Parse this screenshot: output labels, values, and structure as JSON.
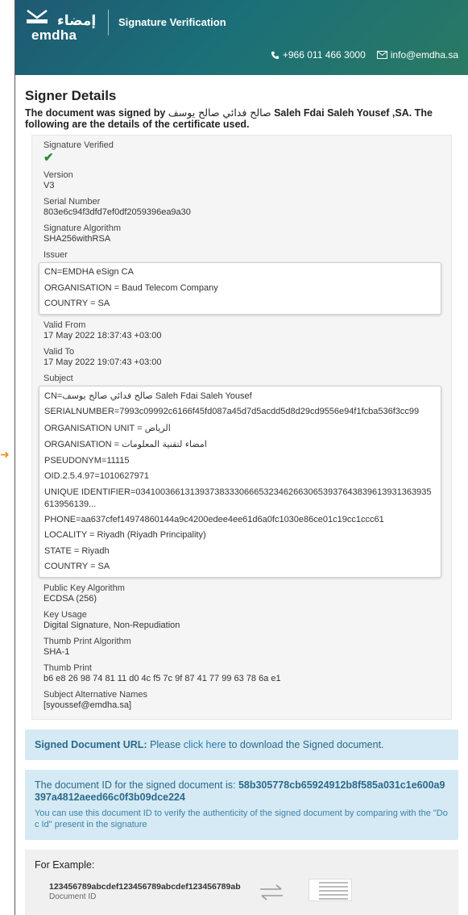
{
  "header": {
    "logo_ar": "إمضاء",
    "logo_en": "emdha",
    "title": "Signature Verification",
    "phone": "+966 011 466 3000",
    "email": "info@emdha.sa",
    "colors": {
      "gradient_start": "#1e5a73",
      "gradient_end": "#2a7a63"
    }
  },
  "page": {
    "title": "Signer Details",
    "intro_prefix": "The document was signed by",
    "signer_ar": "صالح فدائي صالح يوسف",
    "intro_suffix": "Saleh Fdai Saleh Yousef ,SA. The following are the details of the certificate used."
  },
  "details": {
    "signature_verified_label": "Signature Verified",
    "version_label": "Version",
    "version": "V3",
    "serial_label": "Serial Number",
    "serial": "803e6c94f3dfd7ef0df2059396ea9a30",
    "sig_alg_label": "Signature Algorithm",
    "sig_alg": "SHA256withRSA",
    "issuer_label": "Issuer",
    "issuer": [
      "CN=EMDHA eSign CA",
      "ORGANISATION = Baud Telecom Company",
      "COUNTRY = SA"
    ],
    "valid_from_label": "Valid From",
    "valid_from": "17 May 2022 18:37:43 +03:00",
    "valid_to_label": "Valid To",
    "valid_to": "17 May 2022 19:07:43 +03:00",
    "subject_label": "Subject",
    "subject": {
      "cn_prefix": "CN=",
      "cn_ar": "صالح فدائي صالح يوسف",
      "cn_en": "Saleh Fdai Saleh Yousef",
      "serialnumber": "SERIALNUMBER=7993c09992c6166f45fd087a45d7d5acdd5d8d29cd9556e94f1fcba536f3cc99",
      "org_unit_prefix": "ORGANISATION UNIT = ",
      "org_unit_ar": "الرياض",
      "org_prefix": "ORGANISATION = ",
      "org_ar": "امضاء لتقنية المعلومات",
      "pseudonym": "PSEUDONYM=11115",
      "oid": "OID.2.5.4.97=1010627971",
      "unique_id": "UNIQUE IDENTIFIER=034100366131393738333066653234626630653937643839613931363935613956139...",
      "phone": "PHONE=aa637cfef14974860144a9c4200edee4ee61d6a0fc1030e86ce01c19cc1ccc61",
      "locality": "LOCALITY = Riyadh (Riyadh Principality)",
      "state": "STATE = Riyadh",
      "country": "COUNTRY = SA"
    },
    "pk_alg_label": "Public Key Algorithm",
    "pk_alg": "ECDSA (256)",
    "key_usage_label": "Key Usage",
    "key_usage": "Digital Signature, Non-Repudiation",
    "thumb_alg_label": "Thumb Print Algorithm",
    "thumb_alg": "SHA-1",
    "thumb_label": "Thumb Print",
    "thumb": "b6 e8 26 98 74 81 11 d0 4c f5 7c 9f 87 41 77 99 63 78 6a e1",
    "san_label": "Subject Alternative Names",
    "san": "[syoussef@emdha.sa]"
  },
  "signed_url": {
    "bold": "Signed Document URL:",
    "pre": " Please ",
    "link": "click here",
    "post": " to download the Signed document."
  },
  "doc_id": {
    "heading": "The document ID for the signed document is:",
    "id": "58b305778cb65924912b8f585a031c1e600a9397a4812aeed66c0f3b09dce224",
    "note": "You can use this document ID to verify the authenticity of the signed document by comparing with the \"Doc Id\" present in the signature"
  },
  "example": {
    "title": "For Example:",
    "id": "123456789abcdef123456789abcdef123456789ab",
    "caption": "Document ID"
  },
  "icons": [
    "check-icon",
    "phone-icon",
    "mail-icon",
    "swap-arrows-icon",
    "pointer-arrow-icon"
  ]
}
